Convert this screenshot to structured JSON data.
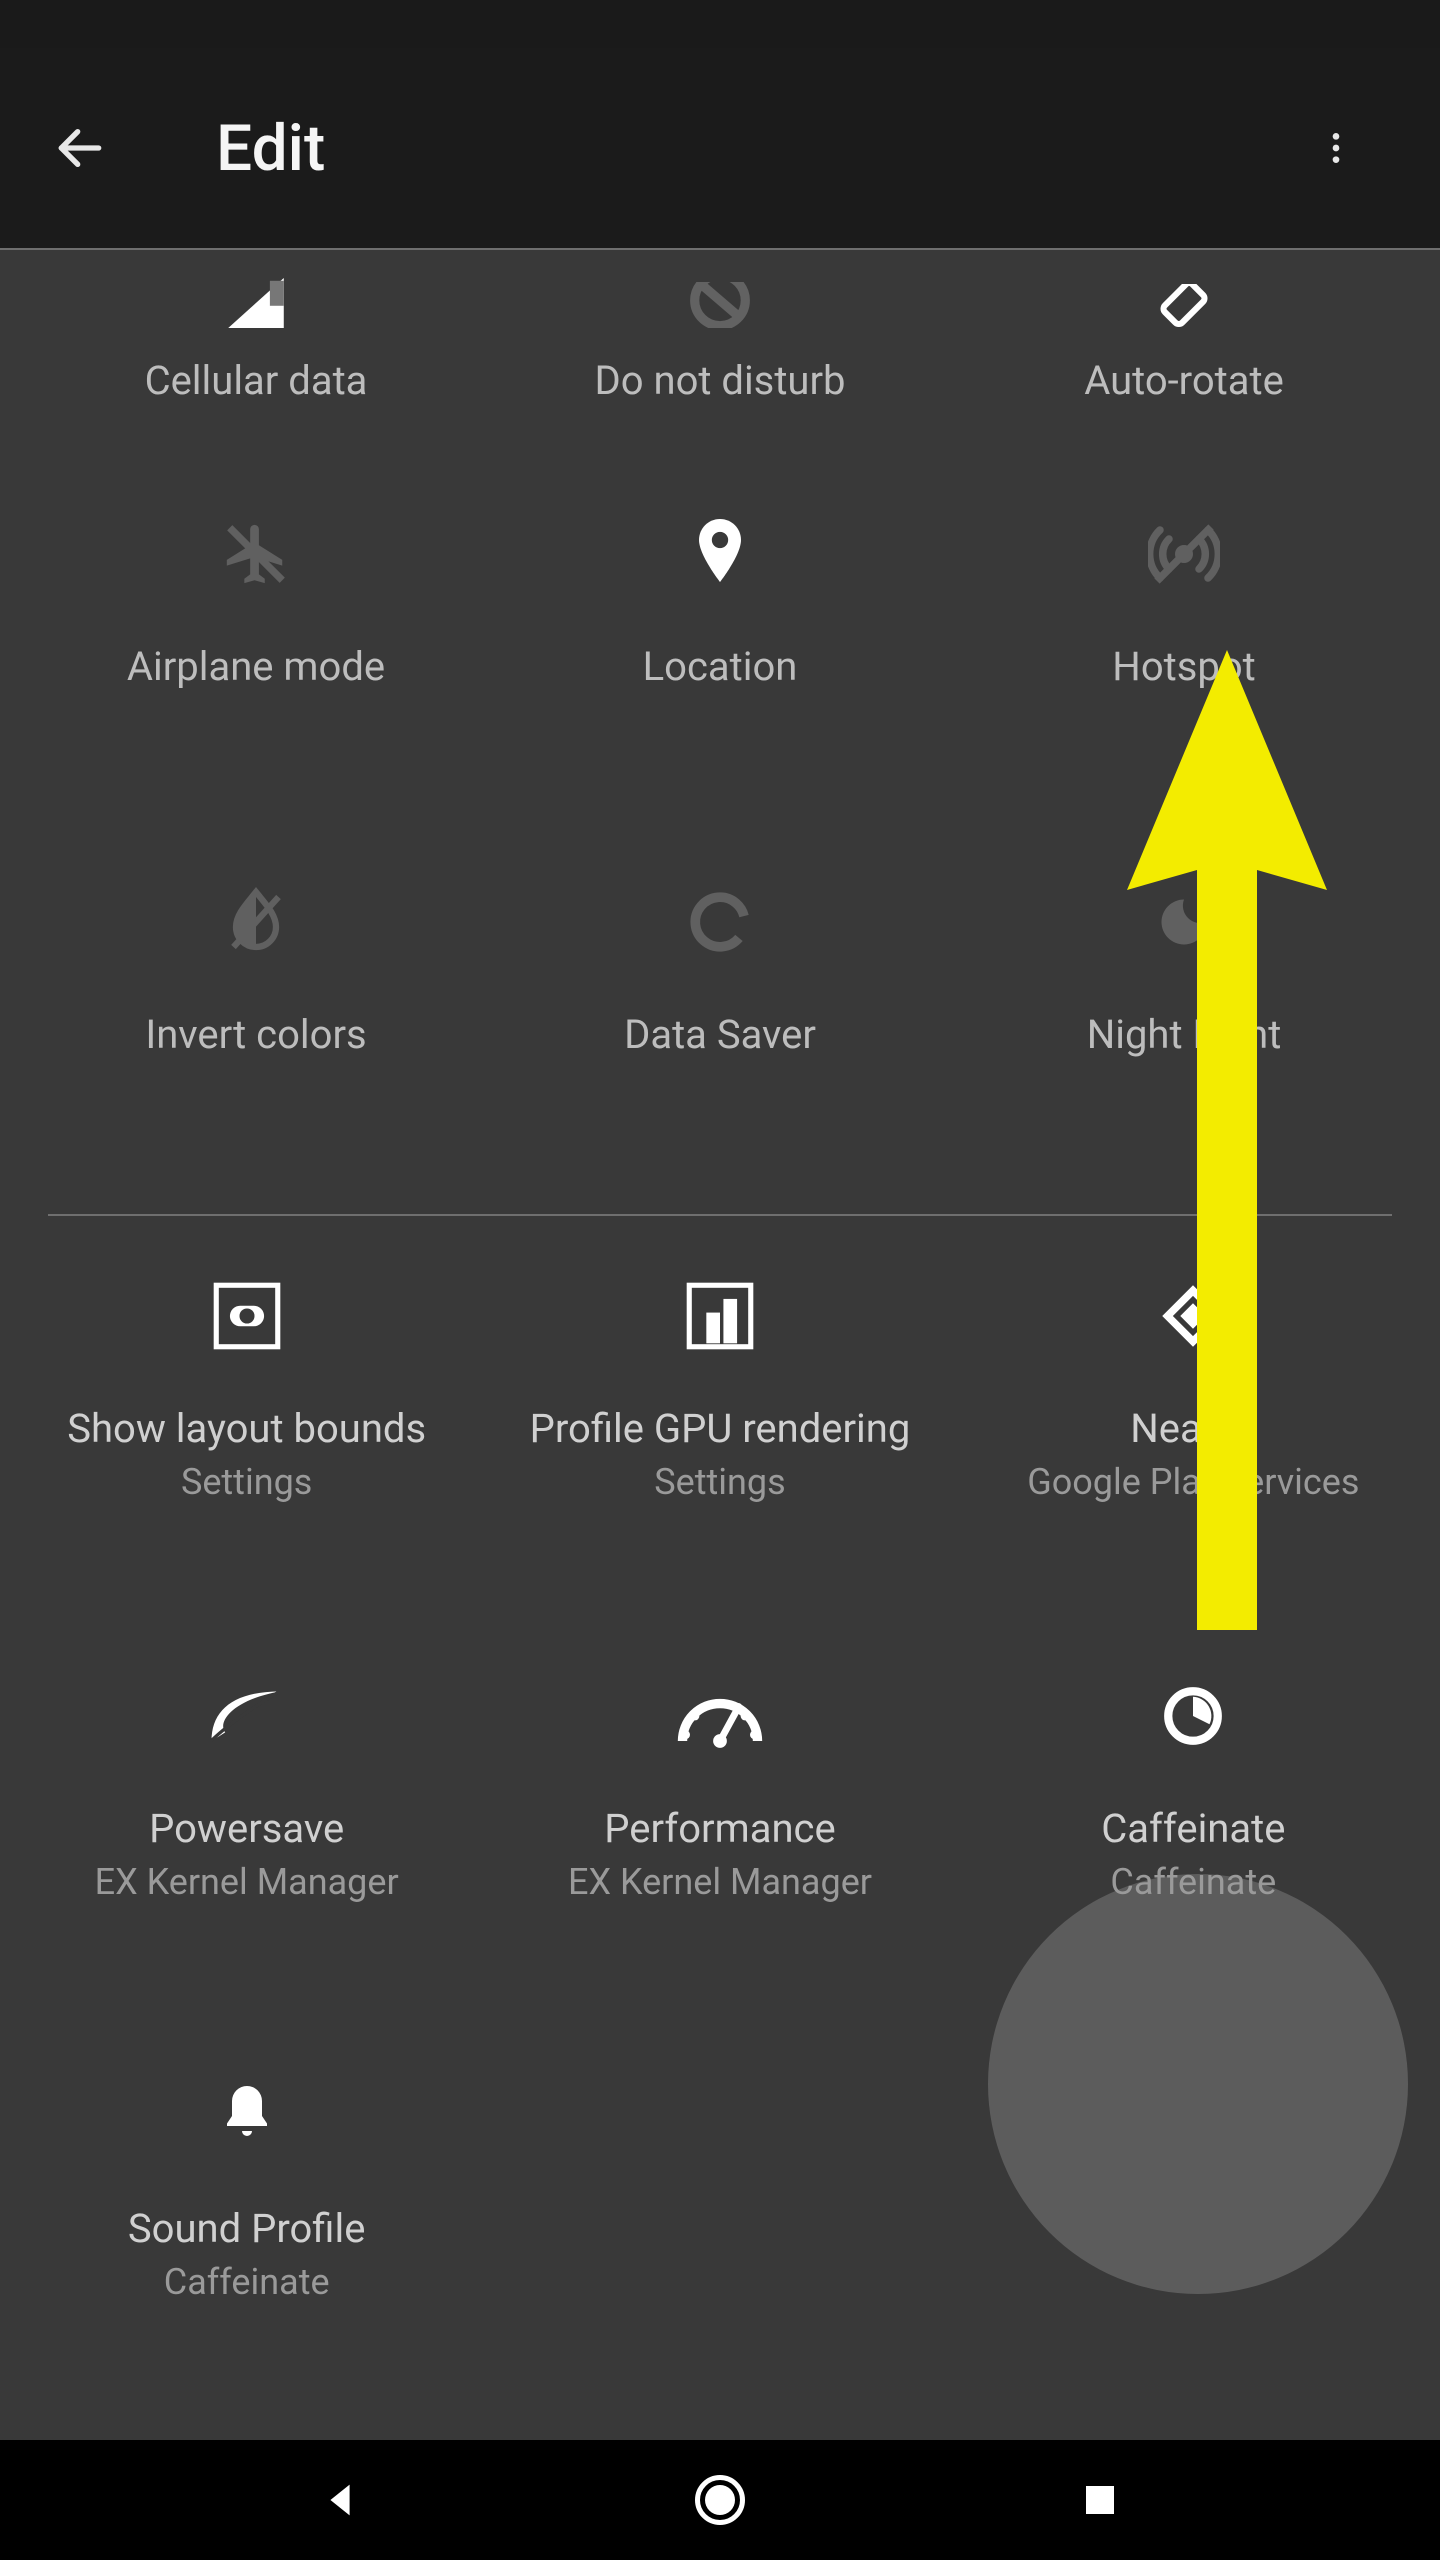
{
  "header": {
    "title": "Edit"
  },
  "grid_top": [
    {
      "label": "Cellular data",
      "icon": "cellular"
    },
    {
      "label": "Do not disturb",
      "icon": "dnd"
    },
    {
      "label": "Auto-rotate",
      "icon": "autorotate"
    }
  ],
  "grid_mid": [
    {
      "label": "Airplane mode",
      "icon": "airplane",
      "muted": true
    },
    {
      "label": "Location",
      "icon": "location",
      "muted": false
    },
    {
      "label": "Hotspot",
      "icon": "hotspot",
      "muted": true
    },
    {
      "label": "Invert colors",
      "icon": "invert",
      "muted": true
    },
    {
      "label": "Data Saver",
      "icon": "datasaver",
      "muted": true
    },
    {
      "label": "Night Light",
      "icon": "nightlight",
      "muted": true
    }
  ],
  "grid_bottom": [
    {
      "label": "Show layout bounds",
      "sublabel": "Settings",
      "icon": "layoutbounds"
    },
    {
      "label": "Profile GPU rendering",
      "sublabel": "Settings",
      "icon": "profilegpu"
    },
    {
      "label": "Nearby",
      "sublabel": "Google Play services",
      "icon": "nearby"
    },
    {
      "label": "Powersave",
      "sublabel": "EX Kernel Manager",
      "icon": "powersave"
    },
    {
      "label": "Performance",
      "sublabel": "EX Kernel Manager",
      "icon": "performance"
    },
    {
      "label": "Caffeinate",
      "sublabel": "Caffeinate",
      "icon": "caffeinate",
      "highlighted": true
    },
    {
      "label": "Sound Profile",
      "sublabel": "Caffeinate",
      "icon": "soundprofile"
    }
  ],
  "annotation": {
    "arrow_color": "#f3ec00",
    "direction": "up"
  },
  "colors": {
    "background": "#393939",
    "header_background": "#1b1b1b",
    "label": "#bdbdbd",
    "sublabel": "#8f8f8f"
  }
}
